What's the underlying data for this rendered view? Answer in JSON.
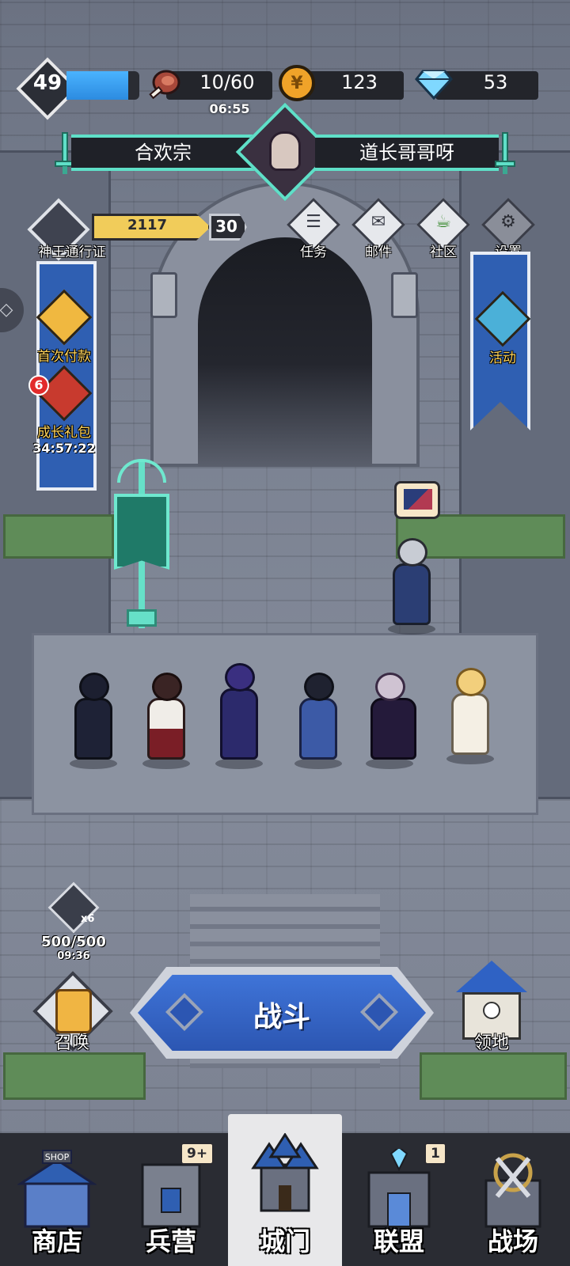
{
  "player": {
    "level": "49",
    "xp_fraction": 0.85
  },
  "resources": {
    "stamina": "10/60",
    "stamina_timer": "06:55",
    "gold": "123",
    "gems": "53"
  },
  "guild": {
    "sect_name": "合欢宗",
    "leader_name": "道长哥哥呀"
  },
  "pass": {
    "points": "2117",
    "level": "30",
    "label": "神王通行证"
  },
  "menu": {
    "items": [
      {
        "label": "任务",
        "icon": "quest-scroll-icon"
      },
      {
        "label": "邮件",
        "icon": "mail-icon"
      },
      {
        "label": "社区",
        "icon": "community-cup-icon"
      },
      {
        "label": "设置",
        "icon": "gear-icon"
      }
    ]
  },
  "side_left": {
    "first_payment_label": "首次付款",
    "growth_pack_label": "成长礼包",
    "growth_pack_badge": "6",
    "growth_pack_timer": "34:57:22"
  },
  "side_right": {
    "event_label": "活动"
  },
  "crown": {
    "multiplier": "x6",
    "count": "500/500",
    "timer": "09:36"
  },
  "actions": {
    "summon_label": "召唤",
    "fight_label": "战斗",
    "territory_label": "领地"
  },
  "nav": {
    "tabs": [
      {
        "label": "商店",
        "badge": "",
        "active": false
      },
      {
        "label": "兵营",
        "badge": "9+",
        "active": false
      },
      {
        "label": "城门",
        "badge": "",
        "active": true
      },
      {
        "label": "联盟",
        "badge": "1",
        "active": false
      },
      {
        "label": "战场",
        "badge": "",
        "active": false
      }
    ],
    "shop_sign": "SHOP"
  },
  "colors": {
    "accent_blue": "#2f5fb2",
    "guild_teal": "#5fe0c8",
    "pass_gold": "#f1cc5a",
    "badge_red": "#e22b2b"
  }
}
